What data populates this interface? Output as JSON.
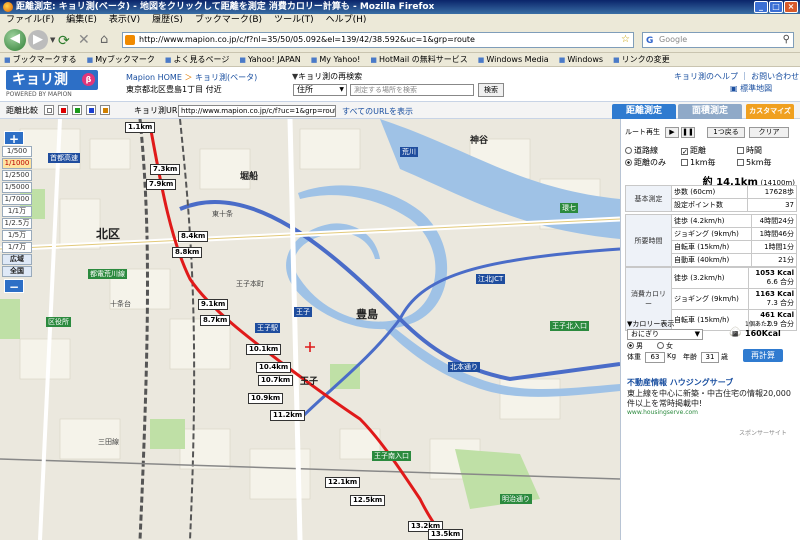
{
  "window": {
    "title": "距離測定: キョリ測(ベータ) - 地図をクリックして距離を測定 消費カロリー計算も - Mozilla Firefox",
    "buttons": [
      "_",
      "□",
      "×"
    ]
  },
  "menu": [
    "ファイル(F)",
    "編集(E)",
    "表示(V)",
    "履歴(S)",
    "ブックマーク(B)",
    "ツール(T)",
    "ヘルプ(H)"
  ],
  "nav": {
    "url": "http://www.mapion.co.jp/c/f?nl=35/50/05.092&el=139/42/38.592&uc=1&grp=route",
    "search_placeholder": "Google"
  },
  "bookmarks": [
    "ブックマークする",
    "Myブックマーク",
    "よく見るページ",
    "Yahoo! JAPAN",
    "My Yahoo!",
    "HotMail の無料サービス",
    "Windows Media",
    "Windows",
    "リンクの変更"
  ],
  "page": {
    "logo": "キョリ測",
    "logo_beta": "β",
    "logo_sub": "POWERED BY MAPION",
    "breadcrumb": [
      "Mapion HOME",
      "キョリ測(ベータ)"
    ],
    "address": "東京都北区豊島1丁目 付近",
    "search_label": "キョリ測の再検索",
    "search_select": "住所",
    "search_placeholder": "測定する場所を検索",
    "search_button": "検索",
    "links": [
      "キョリ測のヘルプ",
      "お問い合わせ"
    ],
    "standard_map": "標準地図"
  },
  "toolbar": {
    "compare_label": "距離比較",
    "url_label": "キョリ測URL:",
    "url_value": "http://www.mapion.co.jp/c/f?uc=1&grp=route8el",
    "all_url": "すべてのURLを表示",
    "tabs": [
      "距離測定",
      "面積測定",
      "カスタマイズ"
    ]
  },
  "map": {
    "zoom_in": "+",
    "zoom_out": "−",
    "scales": [
      "1/500",
      "1/1000",
      "1/2500",
      "1/5000",
      "1/7000",
      "1/1万",
      "1/2.5万",
      "1/5万",
      "1/7万",
      "広域",
      "全国"
    ],
    "active_scale": "1/1000",
    "places": [
      "北区",
      "豊島",
      "王子",
      "十条台",
      "堀船",
      "東十条",
      "神谷",
      "王子本町",
      "三田線"
    ],
    "distance_labels": [
      "1.1km",
      "7.3km",
      "7.9km",
      "8.4km",
      "8.8km",
      "9.1km",
      "8.7km",
      "10.1km",
      "10.4km",
      "10.7km",
      "10.9km",
      "11.2km",
      "12.1km",
      "12.5km",
      "13.2km",
      "13.5km"
    ],
    "road_labels": [
      "首都高速",
      "都電荒川線",
      "王子駅",
      "王子",
      "荒川",
      "王子北入口",
      "王子南入口",
      "江北JCT",
      "明治通り",
      "北本通り",
      "環七",
      "区役所"
    ]
  },
  "panel": {
    "route_buttons": [
      "ルート再生",
      "1つ戻る",
      "クリア"
    ],
    "options": {
      "row1": [
        "道路線",
        "距離",
        "時間"
      ],
      "row2": [
        "距離のみ",
        "1km毎",
        "5km毎"
      ]
    },
    "total_distance": "約 14.1km",
    "total_note": "(14100m)",
    "basic": {
      "title": "基本測定",
      "steps_label": "歩数 (60cm)",
      "steps": "17628歩",
      "points_label": "設定ポイント数",
      "points": "37"
    },
    "time": {
      "title": "所要時間",
      "rows": [
        {
          "label": "徒歩 (4.2km/h)",
          "value": "4時間24分"
        },
        {
          "label": "ジョギング (9km/h)",
          "value": "1時間46分"
        },
        {
          "label": "自転車 (15km/h)",
          "value": "1時間1分"
        },
        {
          "label": "自動車 (40km/h)",
          "value": "21分"
        }
      ]
    },
    "calories": {
      "title": "消費カロリー",
      "rows": [
        {
          "label": "徒歩 (3.2km/h)",
          "value": "1053 Kcal",
          "sub": "6.6 合分"
        },
        {
          "label": "ジョギング (9km/h)",
          "value": "1163 Kcal",
          "sub": "7.3 合分"
        },
        {
          "label": "自転車 (15km/h)",
          "value": "461 Kcal",
          "sub": "2.9 合分"
        }
      ]
    },
    "cal_display_label": "▼カロリー表示",
    "cal_select": "おにぎり",
    "onigiri_note": "1個あたり",
    "onigiri_kcal": "160Kcal",
    "gender": [
      "男",
      "女"
    ],
    "weight_label": "体重",
    "weight": "63",
    "weight_unit": "Kg",
    "age_label": "年齢",
    "age": "31",
    "age_unit": "歳",
    "recalc": "再計算",
    "ad_title": "不動産情報 ハウジングサーブ",
    "ad_body": "東上線を中心に新築・中古住宅の情報20,000件以上を常時掲載中!",
    "ad_url": "www.housingserve.com",
    "sponsor": "スポンサーサイト"
  }
}
